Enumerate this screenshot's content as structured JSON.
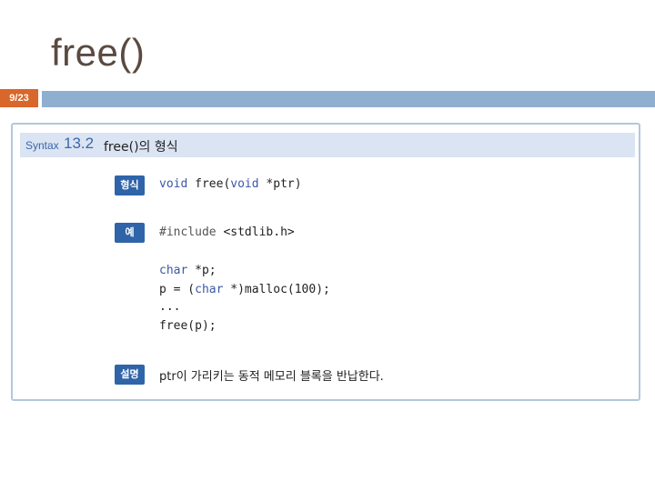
{
  "slide": {
    "title": "free()",
    "page_indicator": "9/23"
  },
  "syntax": {
    "word": "Syntax",
    "number": "13.2",
    "heading": "free()의 형식"
  },
  "rows": {
    "form_tag": "형식",
    "form_code": {
      "kw1": "void",
      "text1": " free(",
      "kw2": "void",
      "text2": " *ptr)"
    },
    "example_tag": "예",
    "example_include": {
      "directive": "#include",
      "header": " <stdlib.h>"
    },
    "example_lines": {
      "line1_kw": "char",
      "line1_rest": " *p;",
      "line2_a": "p = (",
      "line2_kw": "char",
      "line2_b": " *)malloc(100);",
      "line3": "...",
      "line4": "free(p);"
    },
    "desc_tag": "설명",
    "description": "ptr이 가리키는 동적 메모리 블록을 반납한다."
  }
}
